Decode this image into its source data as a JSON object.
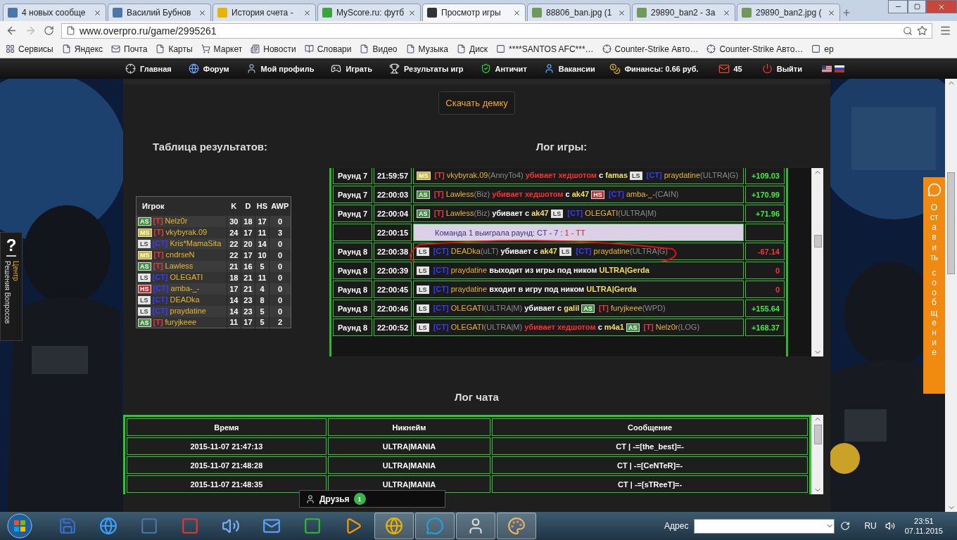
{
  "browser": {
    "tabs": [
      {
        "title": "4 новых сообще",
        "selected": false,
        "color": "#4a76a8"
      },
      {
        "title": "Василий Бубнов",
        "selected": false,
        "color": "#4a76a8"
      },
      {
        "title": "История счета -",
        "selected": false,
        "color": "#e8b400"
      },
      {
        "title": "MyScore.ru: футб",
        "selected": false,
        "color": "#3aa63a"
      },
      {
        "title": "Просмотр игры",
        "selected": true,
        "color": "#333333"
      },
      {
        "title": "88806_ban.jpg (1",
        "selected": false,
        "color": "#6f9a5a"
      },
      {
        "title": "29890_ban2 - За",
        "selected": false,
        "color": "#6f9a5a"
      },
      {
        "title": "29890_ban2.jpg (",
        "selected": false,
        "color": "#6f9a5a"
      }
    ],
    "url": "www.overpro.ru/game/2995261",
    "bookmarks": [
      "Сервисы",
      "Яндекс",
      "Почта",
      "Карты",
      "Маркет",
      "Новости",
      "Словари",
      "Видео",
      "Музыка",
      "Диск",
      "****SANTOS AFC***…",
      "Counter-Strike Авто…",
      "Counter-Strike Авто…",
      "ep"
    ]
  },
  "site_nav": {
    "items": [
      "Главная",
      "Форум",
      "Мой профиль",
      "Играть",
      "Результаты игр",
      "Античит",
      "Вакансии"
    ],
    "finance": "Финансы: 0.66 руб.",
    "messages": "45",
    "logout": "Выйти"
  },
  "download_button": "Скачать демку",
  "results": {
    "title": "Таблица результатов:",
    "columns": [
      "Игрок",
      "K",
      "D",
      "HS",
      "AWP"
    ],
    "rows": [
      {
        "badge": {
          "text": "AS",
          "color": "#3f8f3f"
        },
        "team": {
          "text": "[T]",
          "color": "#e23b3b"
        },
        "name": "Nelz0r",
        "k": "30",
        "d": "18",
        "hs": "17",
        "awp": "0"
      },
      {
        "badge": {
          "text": "MS",
          "color": "#c8b832"
        },
        "team": {
          "text": "[T]",
          "color": "#e23b3b"
        },
        "name": "vkybyrak.09",
        "k": "24",
        "d": "17",
        "hs": "11",
        "awp": "3"
      },
      {
        "badge": {
          "text": "LS",
          "color": "#e6e6e6"
        },
        "team": {
          "text": "[CT]",
          "color": "#3a3aff"
        },
        "name": "Kris*MamaSita",
        "k": "22",
        "d": "20",
        "hs": "14",
        "awp": "0"
      },
      {
        "badge": {
          "text": "MS",
          "color": "#c8b832"
        },
        "team": {
          "text": "[T]",
          "color": "#e23b3b"
        },
        "name": "cndrseN",
        "k": "22",
        "d": "17",
        "hs": "10",
        "awp": "0"
      },
      {
        "badge": {
          "text": "AS",
          "color": "#3f8f3f"
        },
        "team": {
          "text": "[T]",
          "color": "#e23b3b"
        },
        "name": "Lawless",
        "k": "21",
        "d": "16",
        "hs": "5",
        "awp": "0"
      },
      {
        "badge": {
          "text": "LS",
          "color": "#e6e6e6"
        },
        "team": {
          "text": "[CT]",
          "color": "#3a3aff"
        },
        "name": "OLEGATI",
        "k": "18",
        "d": "21",
        "hs": "11",
        "awp": "0"
      },
      {
        "badge": {
          "text": "HS",
          "color": "#c42a2a"
        },
        "team": {
          "text": "[CT]",
          "color": "#3a3aff"
        },
        "name": "amba-_-",
        "k": "17",
        "d": "21",
        "hs": "4",
        "awp": "0"
      },
      {
        "badge": {
          "text": "LS",
          "color": "#e6e6e6"
        },
        "team": {
          "text": "[CT]",
          "color": "#3a3aff"
        },
        "name": "DEADka",
        "k": "14",
        "d": "23",
        "hs": "8",
        "awp": "0"
      },
      {
        "badge": {
          "text": "LS",
          "color": "#e6e6e6"
        },
        "team": {
          "text": "[CT]",
          "color": "#3a3aff"
        },
        "name": "praydatine",
        "k": "14",
        "d": "23",
        "hs": "5",
        "awp": "0"
      },
      {
        "badge": {
          "text": "AS",
          "color": "#3f8f3f"
        },
        "team": {
          "text": "[T]",
          "color": "#e23b3b"
        },
        "name": "furyjkeee",
        "k": "11",
        "d": "17",
        "hs": "5",
        "awp": "2"
      }
    ]
  },
  "game_log": {
    "title": "Лог игры:",
    "rows": [
      {
        "round": "Раунд 7",
        "time": "21:59:57",
        "highlight": false,
        "circled": false,
        "points": "+109.03",
        "positive": true,
        "event": [
          {
            "kind": "badge",
            "text": "MS",
            "color": "#c8b832"
          },
          {
            "kind": "team",
            "text": "[T]",
            "color": "#e23b3b"
          },
          {
            "kind": "player",
            "text": "vkybyrak.09"
          },
          {
            "kind": "clan",
            "text": "(AnnyTo4)"
          },
          {
            "kind": "headshot",
            "text": "убивает хедшотом"
          },
          {
            "kind": "action",
            "text": "с"
          },
          {
            "kind": "weapon",
            "text": "famas"
          },
          {
            "kind": "badge",
            "text": "LS",
            "color": "#e6e6e6"
          },
          {
            "kind": "team",
            "text": "[CT]",
            "color": "#3a3aff"
          },
          {
            "kind": "player",
            "text": "praydatine"
          },
          {
            "kind": "clan",
            "text": "(ULTRA|G)"
          }
        ]
      },
      {
        "round": "Раунд 7",
        "time": "22:00:03",
        "highlight": false,
        "circled": false,
        "points": "+170.99",
        "positive": true,
        "event": [
          {
            "kind": "badge",
            "text": "AS",
            "color": "#3f8f3f"
          },
          {
            "kind": "team",
            "text": "[T]",
            "color": "#e23b3b"
          },
          {
            "kind": "player",
            "text": "Lawless"
          },
          {
            "kind": "clan",
            "text": "(Biz)"
          },
          {
            "kind": "headshot",
            "text": "убивает хедшотом"
          },
          {
            "kind": "action",
            "text": "с"
          },
          {
            "kind": "weapon",
            "text": "ak47"
          },
          {
            "kind": "badge",
            "text": "HS",
            "color": "#c42a2a"
          },
          {
            "kind": "team",
            "text": "[CT]",
            "color": "#3a3aff"
          },
          {
            "kind": "player",
            "text": "amba-_-"
          },
          {
            "kind": "clan",
            "text": "(CAIN)"
          }
        ]
      },
      {
        "round": "Раунд 7",
        "time": "22:00:04",
        "highlight": false,
        "circled": false,
        "points": "+71.96",
        "positive": true,
        "event": [
          {
            "kind": "badge",
            "text": "AS",
            "color": "#3f8f3f"
          },
          {
            "kind": "team",
            "text": "[T]",
            "color": "#e23b3b"
          },
          {
            "kind": "player",
            "text": "Lawless"
          },
          {
            "kind": "clan",
            "text": "(Biz)"
          },
          {
            "kind": "action",
            "text": "убивает с"
          },
          {
            "kind": "weapon",
            "text": "ak47"
          },
          {
            "kind": "badge",
            "text": "LS",
            "color": "#e6e6e6"
          },
          {
            "kind": "team",
            "text": "[CT]",
            "color": "#3a3aff"
          },
          {
            "kind": "player",
            "text": "OLEGATI"
          },
          {
            "kind": "clan",
            "text": "(ULTRA|M)"
          }
        ]
      },
      {
        "time": "22:00:15",
        "highlight": true,
        "circled": false,
        "event": [
          {
            "kind": "info",
            "text": "Команда 1 выиграла раунд: CT - 7 :"
          },
          {
            "kind": "loss",
            "text": "1 - TT"
          }
        ]
      },
      {
        "round": "Раунд 8",
        "time": "22:00:38",
        "highlight": false,
        "circled": true,
        "points": "-67.14",
        "positive": false,
        "event": [
          {
            "kind": "badge",
            "text": "LS",
            "color": "#e6e6e6"
          },
          {
            "kind": "team",
            "text": "[CT]",
            "color": "#3a3aff"
          },
          {
            "kind": "player",
            "text": "DEADka"
          },
          {
            "kind": "clan",
            "text": "(uLT)"
          },
          {
            "kind": "action",
            "text": "убивает с"
          },
          {
            "kind": "weapon",
            "text": "ak47"
          },
          {
            "kind": "badge",
            "text": "LS",
            "color": "#e6e6e6"
          },
          {
            "kind": "team",
            "text": "[CT]",
            "color": "#3a3aff"
          },
          {
            "kind": "player",
            "text": "praydatine"
          },
          {
            "kind": "clan",
            "text": "(ULTRA|G)"
          }
        ]
      },
      {
        "round": "Раунд 8",
        "time": "22:00:39",
        "highlight": false,
        "circled": false,
        "points": "0",
        "positive": false,
        "event": [
          {
            "kind": "badge",
            "text": "LS",
            "color": "#e6e6e6"
          },
          {
            "kind": "team",
            "text": "[CT]",
            "color": "#3a3aff"
          },
          {
            "kind": "player",
            "text": "praydatine"
          },
          {
            "kind": "action",
            "text": "выходит из игры под ником"
          },
          {
            "kind": "weapon",
            "text": "ULTRA|Gerda"
          }
        ]
      },
      {
        "round": "Раунд 8",
        "time": "22:00:45",
        "highlight": false,
        "circled": false,
        "points": "0",
        "positive": false,
        "event": [
          {
            "kind": "badge",
            "text": "LS",
            "color": "#e6e6e6"
          },
          {
            "kind": "team",
            "text": "[CT]",
            "color": "#3a3aff"
          },
          {
            "kind": "player",
            "text": "praydatine"
          },
          {
            "kind": "action",
            "text": "входит в игру под ником"
          },
          {
            "kind": "weapon",
            "text": "ULTRA|Gerda"
          }
        ]
      },
      {
        "round": "Раунд 8",
        "time": "22:00:46",
        "highlight": false,
        "circled": false,
        "points": "+155.64",
        "positive": true,
        "event": [
          {
            "kind": "badge",
            "text": "LS",
            "color": "#e6e6e6"
          },
          {
            "kind": "team",
            "text": "[CT]",
            "color": "#3a3aff"
          },
          {
            "kind": "player",
            "text": "OLEGATI"
          },
          {
            "kind": "clan",
            "text": "(ULTRA|M)"
          },
          {
            "kind": "action",
            "text": "убивает с"
          },
          {
            "kind": "weapon",
            "text": "galil"
          },
          {
            "kind": "badge",
            "text": "AS",
            "color": "#3f8f3f"
          },
          {
            "kind": "team",
            "text": "[T]",
            "color": "#e23b3b"
          },
          {
            "kind": "player",
            "text": "furyjkeee"
          },
          {
            "kind": "clan",
            "text": "(WPD)"
          }
        ]
      },
      {
        "round": "Раунд 8",
        "time": "22:00:52",
        "highlight": false,
        "circled": false,
        "points": "+168.37",
        "positive": true,
        "event": [
          {
            "kind": "badge",
            "text": "LS",
            "color": "#e6e6e6"
          },
          {
            "kind": "team",
            "text": "[CT]",
            "color": "#3a3aff"
          },
          {
            "kind": "player",
            "text": "OLEGATI"
          },
          {
            "kind": "clan",
            "text": "(ULTRA|M)"
          },
          {
            "kind": "headshot",
            "text": "убивает хедшотом"
          },
          {
            "kind": "action",
            "text": "с"
          },
          {
            "kind": "weapon",
            "text": "m4a1"
          },
          {
            "kind": "badge",
            "text": "AS",
            "color": "#3f8f3f"
          },
          {
            "kind": "team",
            "text": "[T]",
            "color": "#e23b3b"
          },
          {
            "kind": "player",
            "text": "Nelz0r"
          },
          {
            "kind": "clan",
            "text": "(LOG)"
          }
        ]
      }
    ]
  },
  "chat_log": {
    "title": "Лог чата",
    "columns": [
      "Время",
      "Никнейм",
      "Сообщение"
    ],
    "rows": [
      {
        "time": "2015-11-07 21:47:13",
        "nick": "ULTRA|MANIA",
        "message": "CT | -=[the_best]=-"
      },
      {
        "time": "2015-11-07 21:48:28",
        "nick": "ULTRA|MANIA",
        "message": "CT | -=[CeNTeR]=-"
      },
      {
        "time": "2015-11-07 21:48:35",
        "nick": "ULTRA|MANIA",
        "message": "CT | -=[sTReeT]=-"
      }
    ]
  },
  "help_tab": {
    "mark": "?",
    "title": "Центр",
    "subtitle": "Решения Вопросов"
  },
  "feedback_tab": {
    "lines": [
      "Оставить",
      "сообщение"
    ]
  },
  "friends": {
    "label": "Друзья",
    "count": "1"
  },
  "taskbar": {
    "apps": [
      {
        "running": false
      },
      {
        "running": false
      },
      {
        "running": false
      },
      {
        "running": false
      },
      {
        "running": false
      },
      {
        "running": false
      },
      {
        "running": false
      },
      {
        "running": false
      },
      {
        "running": true
      },
      {
        "running": true
      },
      {
        "running": true
      },
      {
        "running": true
      }
    ],
    "address_label": "Адрес",
    "language": "RU",
    "time": "23:51",
    "date": "07.11.2015"
  }
}
